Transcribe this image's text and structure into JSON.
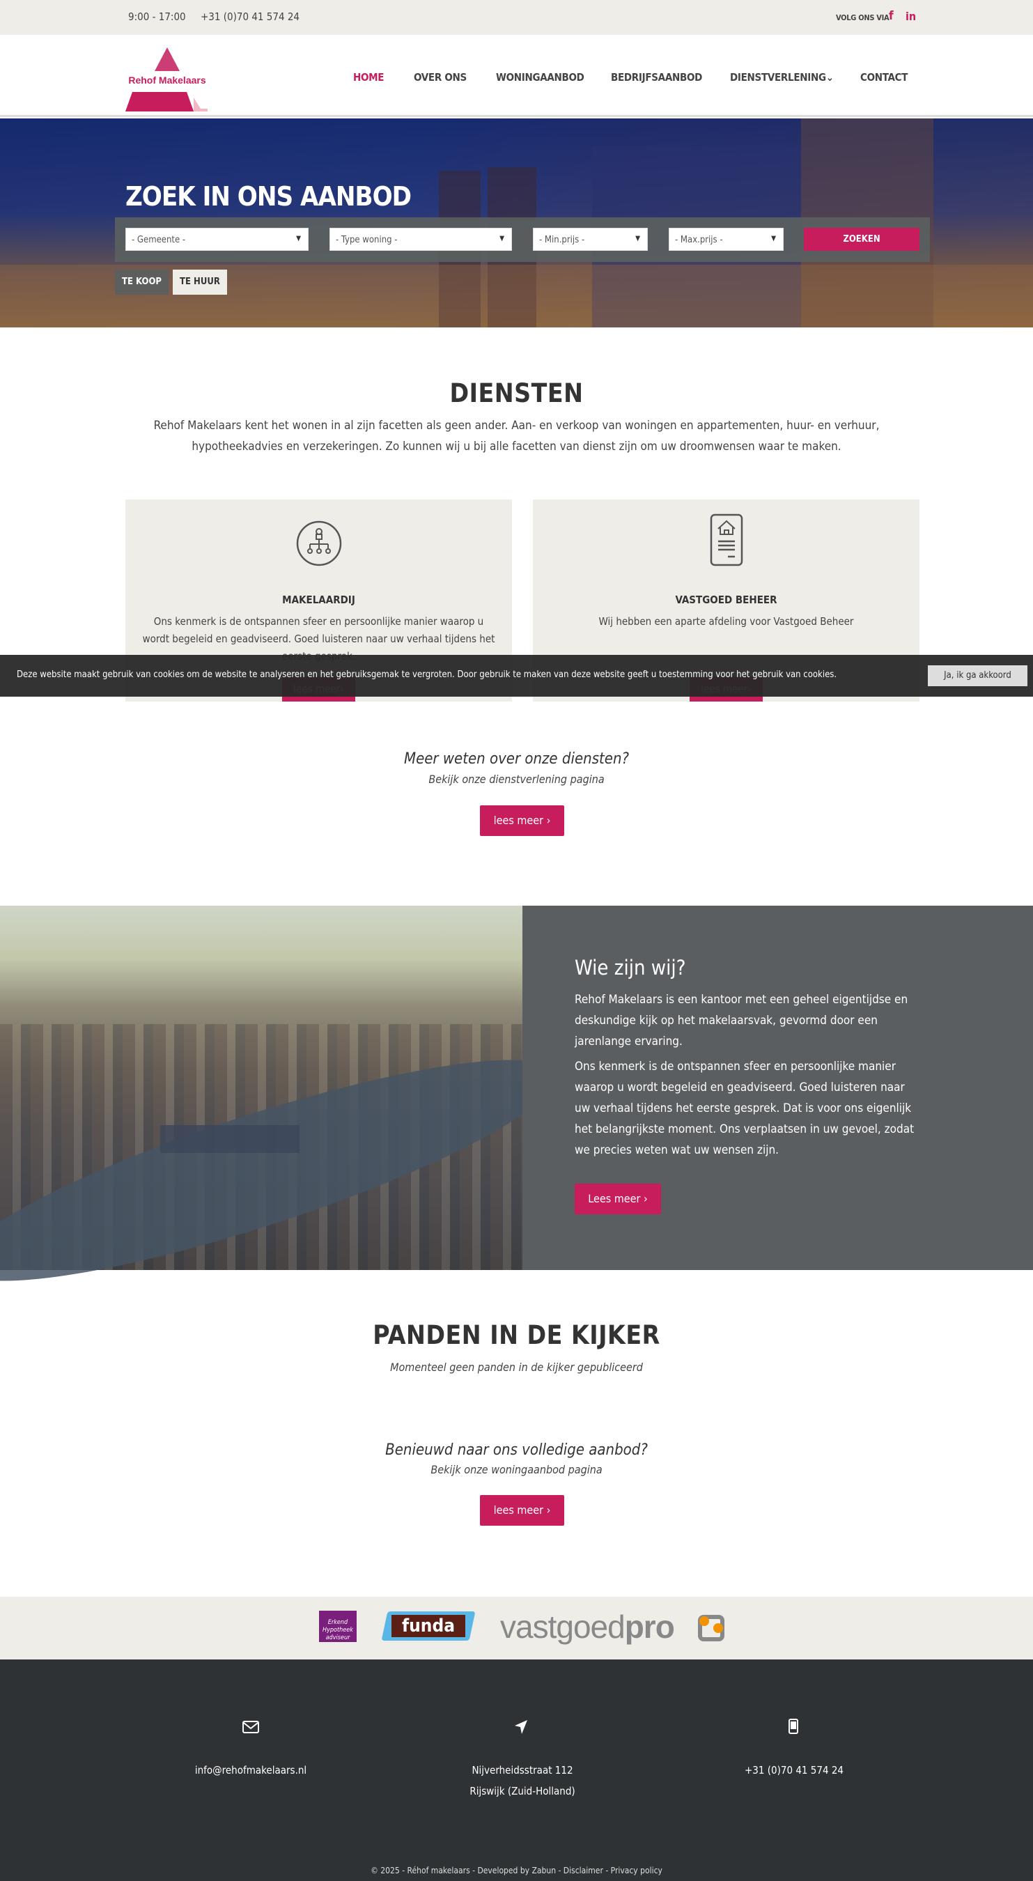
{
  "topbar": {
    "hours": "9:00 - 17:00",
    "phone": "+31 (0)70 41 574 24",
    "follow": "VOLG ONS VIA",
    "facebook": "f",
    "linkedin": "in"
  },
  "logo": {
    "text": "Rehof Makelaars"
  },
  "nav": [
    {
      "label": "HOME",
      "active": true
    },
    {
      "label": "OVER ONS"
    },
    {
      "label": "WONINGAANBOD"
    },
    {
      "label": "BEDRIJFSAANBOD"
    },
    {
      "label": "DIENSTVERLENING⌄"
    },
    {
      "label": "CONTACT"
    }
  ],
  "hero": {
    "title": "ZOEK IN ONS AANBOD",
    "selects": [
      "- Gemeente -",
      "- Type woning -",
      "- Min.prijs -",
      "- Max.prijs -"
    ],
    "search": "ZOEKEN",
    "tabs": [
      "TE KOOP",
      "TE HUUR"
    ]
  },
  "diensten": {
    "title": "DIENSTEN",
    "intro1": "Rehof Makelaars kent het wonen in al zijn facetten als geen ander. Aan- en verkoop van woningen en appartementen, huur- en verhuur,",
    "intro2": "hypotheekadvies en verzekeringen. Zo kunnen wij u bij alle facetten van dienst zijn om uw droomwensen waar te maken.",
    "cards": [
      {
        "title": "MAKELAARDIJ",
        "desc": "Ons kenmerk is de ontspannen sfeer en persoonlijke manier waarop u wordt begeleid en geadviseerd. Goed luisteren naar uw verhaal tijdens het eerste gesprek.",
        "button": "lees meer›",
        "icon": "org-chart-icon"
      },
      {
        "title": "VASTGOED BEHEER",
        "desc": "Wij hebben een aparte afdeling voor Vastgoed Beheer",
        "button": "lees meer›",
        "icon": "house-document-icon"
      }
    ],
    "more_title": "Meer weten over onze diensten?",
    "more_sub": "Bekijk onze dienstverlening pagina",
    "more_button": "lees meer ›"
  },
  "cookie": {
    "text": "Deze website maakt gebruik van cookies om de website te analyseren en het gebruiksgemak te vergroten. Door gebruik te maken van deze website geeft u toestemming voor het gebruik van cookies.",
    "accept": "Ja, ik ga akkoord"
  },
  "about": {
    "title": "Wie zijn wij?",
    "p1": "Rehof Makelaars is een kantoor met een geheel eigentijdse en deskundige kijk op het makelaarsvak, gevormd door een jarenlange ervaring.",
    "p2": "Ons kenmerk is de ontspannen sfeer en persoonlijke manier waarop u wordt begeleid en geadviseerd. Goed luisteren naar uw verhaal tijdens het eerste gesprek. Dat is voor ons eigenlijk het belangrijkste moment. Ons verplaatsen in uw gevoel, zodat we precies weten wat uw wensen zijn.",
    "button": "Lees meer ›"
  },
  "panden": {
    "title": "PANDEN IN DE KIJKER",
    "empty": "Momenteel geen panden in de kijker gepubliceerd",
    "more_title": "Benieuwd naar ons volledige aanbod?",
    "more_sub": "Bekijk onze woningaanbod pagina",
    "more_button": "lees meer ›"
  },
  "partners": {
    "erkend": [
      "Erkend",
      "Hypotheek",
      "adviseur"
    ],
    "funda": "funda",
    "vastgoed": "vastgoed",
    "pro": "pro"
  },
  "footer": {
    "email": "info@rehofmakelaars.nl",
    "address1": "Nijverheidsstraat 112",
    "address2": "Rijswijk (Zuid-Holland)",
    "phone": "+31 (0)70 41 574 24",
    "copyright": "© 2025 - Réhof makelaars - Developed by Zabun - Disclaimer - Privacy policy"
  },
  "colors": {
    "accent": "#c81d5c",
    "footer": "#2f3234",
    "panel": "#5a5e60",
    "light": "#eeede8"
  }
}
